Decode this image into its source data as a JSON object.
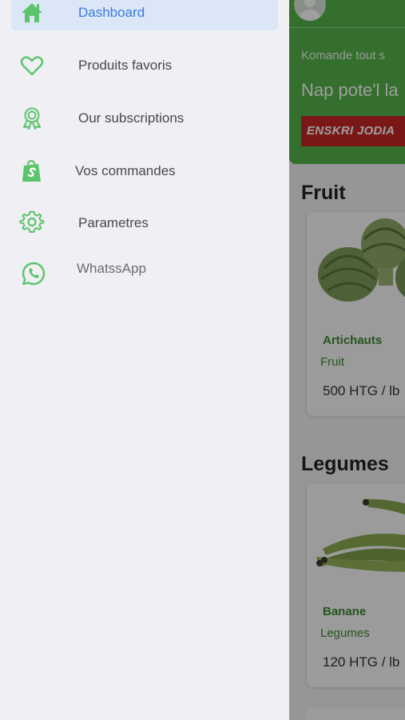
{
  "drawer": {
    "items": [
      {
        "label": "Dashboard",
        "icon": "home-icon",
        "active": true
      },
      {
        "label": "Produits favoris",
        "icon": "heart-icon"
      },
      {
        "label": "Our subscriptions",
        "icon": "award-icon"
      },
      {
        "label": "Vos commandes",
        "icon": "shopify-bag-icon"
      },
      {
        "label": "Parametres",
        "icon": "gear-icon"
      },
      {
        "label": "WhatssApp",
        "icon": "whatsapp-icon"
      }
    ],
    "icon_color": "#5cc46a",
    "active_color": "#3b7be0"
  },
  "header": {
    "subtitle": "Komande tout s",
    "title": "Nap pote'l la",
    "cta_label": "ENSKRI JODIA",
    "colors": {
      "background": "#55b349",
      "cta": "#c62828"
    }
  },
  "sections": [
    {
      "title": "Fruit",
      "product": {
        "name": "Artichauts",
        "category": "Fruit",
        "price": "500 HTG / lb"
      }
    },
    {
      "title": "Legumes",
      "product": {
        "name": "Banane",
        "category": "Legumes",
        "price": "120 HTG / lb"
      }
    }
  ]
}
